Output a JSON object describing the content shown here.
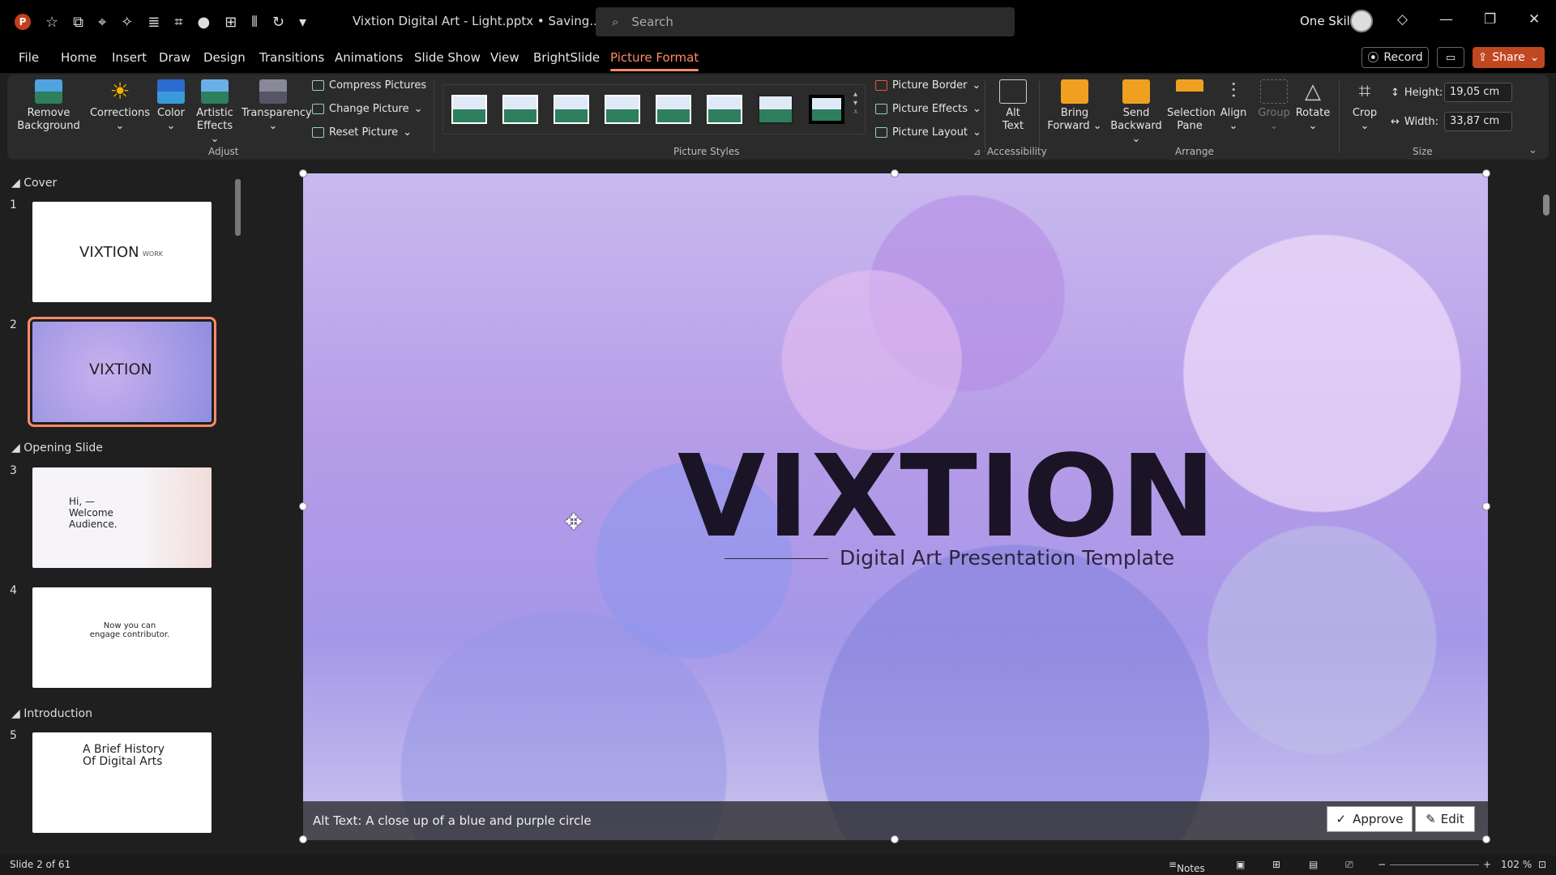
{
  "app": {
    "doc_title": "Vixtion Digital Art - Light.pptx • Saving...",
    "search_placeholder": "Search",
    "user_name": "One Skill",
    "app_icon": "powerpoint-icon",
    "app_letter": "P",
    "qat_icons": [
      "star-icon",
      "copy-icon",
      "target-icon",
      "magic-icon",
      "align-icon",
      "crop-icon",
      "record-icon",
      "layout-icon",
      "distribute-icon",
      "redo-icon",
      "customize-icon"
    ],
    "window_controls": [
      "minimize-icon",
      "restore-icon",
      "close-icon"
    ]
  },
  "menu": {
    "items": [
      "File",
      "Home",
      "Insert",
      "Draw",
      "Design",
      "Transitions",
      "Animations",
      "Slide Show",
      "View",
      "BrightSlide",
      "Picture Format"
    ],
    "active": "Picture Format",
    "record": "Record",
    "share": "Share"
  },
  "ribbon": {
    "adjust": {
      "remove_bg": "Remove Background",
      "corrections": "Corrections",
      "color": "Color",
      "artistic": "Artistic Effects",
      "transparency": "Transparency",
      "compress": "Compress Pictures",
      "change": "Change Picture",
      "reset": "Reset Picture",
      "label": "Adjust"
    },
    "styles": {
      "label": "Picture Styles",
      "border": "Picture Border",
      "effects": "Picture Effects",
      "layout": "Picture Layout"
    },
    "accessibility": {
      "alt_text": "Alt Text",
      "label": "Accessibility"
    },
    "arrange": {
      "bring_forward": "Bring Forward",
      "send_backward": "Send Backward",
      "selection_pane": "Selection Pane",
      "align": "Align",
      "group": "Group",
      "rotate": "Rotate",
      "label": "Arrange"
    },
    "size": {
      "crop": "Crop",
      "height_label": "Height:",
      "height_value": "19,05 cm",
      "width_label": "Width:",
      "width_value": "33,87 cm",
      "label": "Size"
    }
  },
  "slides_panel": {
    "sections": [
      "Cover",
      "Opening Slide",
      "Introduction"
    ],
    "slides": [
      {
        "num": "1",
        "text": "VIXTION",
        "sub": "WORK"
      },
      {
        "num": "2",
        "text": "VIXTION"
      },
      {
        "num": "3",
        "text": "Hi, — Welcome Audience."
      },
      {
        "num": "4",
        "text": "Now you can engage contributor."
      },
      {
        "num": "5",
        "text": "A Brief History Of Digital Arts"
      }
    ]
  },
  "slide": {
    "title": "VIXTION",
    "subtitle": "Digital Art Presentation Template",
    "alt_text": "Alt Text: A close up of a blue and purple circle",
    "approve": "Approve",
    "edit": "Edit"
  },
  "status": {
    "slide_info": "Slide 2 of 61",
    "notes": "Notes",
    "zoom": "102 %"
  },
  "colors": {
    "accent": "#ff8a65",
    "share": "#c04820"
  }
}
